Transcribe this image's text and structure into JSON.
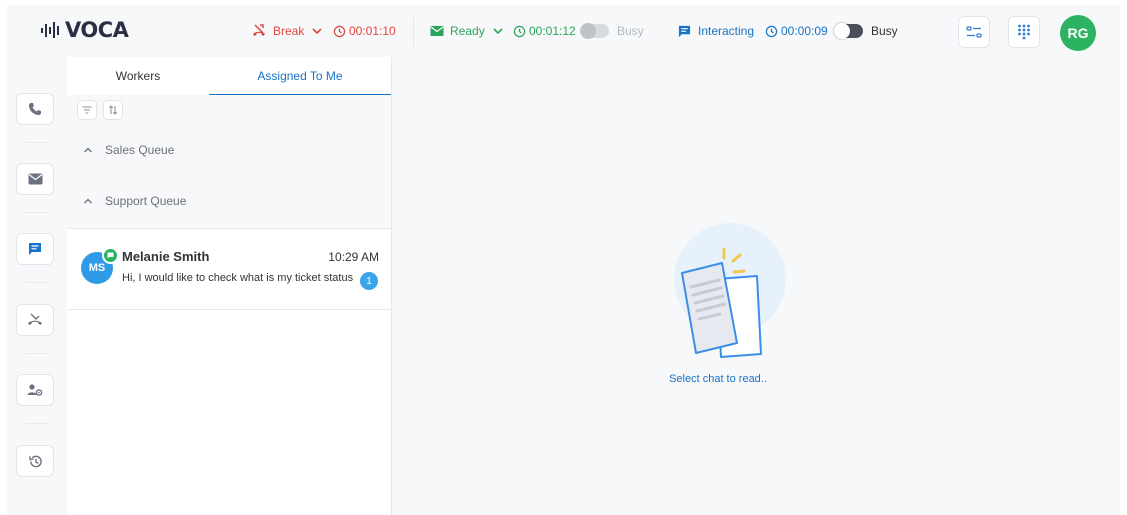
{
  "app": {
    "logo_text": "VOCA",
    "logo_icon": "equalizer-bars-icon"
  },
  "status_bar": {
    "break": {
      "label": "Break",
      "timer": "00:01:10",
      "color": "#e0463c"
    },
    "ready": {
      "label": "Ready",
      "timer": "00:01:12",
      "busy_label": "Busy",
      "color": "#2aa65a"
    },
    "interacting": {
      "label": "Interacting",
      "timer": "00:00:09",
      "busy_label": "Busy",
      "color": "#1a73c8"
    }
  },
  "header_actions": {
    "settings_icon": "sliders-icon",
    "dialpad_icon": "dialpad-icon",
    "user_initials": "RG",
    "avatar_color": "#2bb361"
  },
  "sidebar": {
    "items": [
      {
        "name": "phone",
        "icon": "phone-icon"
      },
      {
        "name": "email",
        "icon": "envelope-icon"
      },
      {
        "name": "chat",
        "icon": "chat-icon",
        "active": true
      },
      {
        "name": "missed-calls",
        "icon": "missed-call-icon"
      },
      {
        "name": "user-settings",
        "icon": "user-gear-icon"
      },
      {
        "name": "history",
        "icon": "history-icon"
      }
    ]
  },
  "chat_list": {
    "tabs": [
      {
        "label": "Workers",
        "active": false
      },
      {
        "label": "Assigned To Me",
        "active": true
      }
    ],
    "toolbar": {
      "filter_icon": "filter-icon",
      "sort_icon": "sort-icon"
    },
    "queues": [
      {
        "label": "Sales Queue"
      },
      {
        "label": "Support Queue"
      }
    ],
    "chats": [
      {
        "initials": "MS",
        "name": "Melanie Smith",
        "time": "10:29 AM",
        "preview": "Hi, I would like to check what is my ticket status",
        "unread": "1"
      }
    ]
  },
  "content": {
    "empty_text": "Select chat to read.."
  }
}
